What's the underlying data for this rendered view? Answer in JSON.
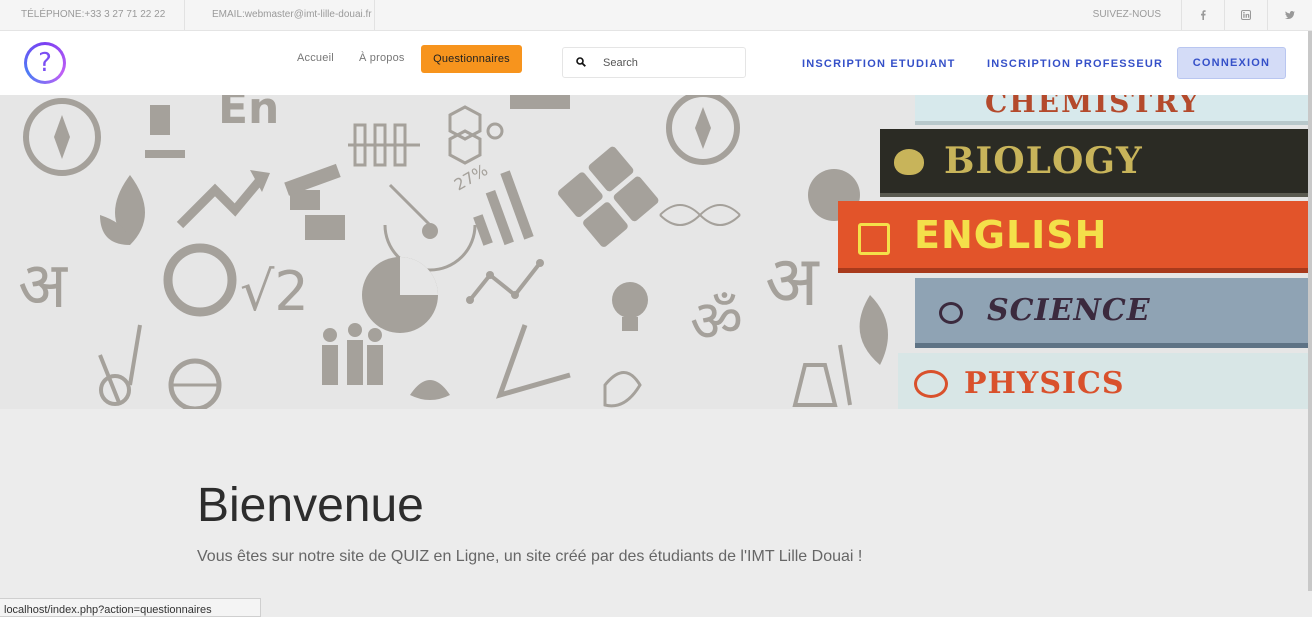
{
  "topbar": {
    "phone": "TÉLÉPHONE:+33 3 27 71 22 22",
    "email": "EMAIL:webmaster@imt-lille-douai.fr",
    "follow": "SUIVEZ-NOUS",
    "social_icons": [
      "facebook-icon",
      "linkedin-icon",
      "twitter-icon"
    ]
  },
  "nav": {
    "accueil": "Accueil",
    "apropos": "À propos",
    "questionnaires": "Questionnaires",
    "search_placeholder": "Search",
    "inscription_etudiant": "INSCRIPTION ETUDIANT",
    "inscription_professeur": "INSCRIPTION PROFESSEUR",
    "connexion": "CONNEXION"
  },
  "hero": {
    "books": [
      {
        "label": "CHEMISTRY",
        "bg": "#d7e9ec",
        "fg": "#b44a2c"
      },
      {
        "label": "BIOLOGY",
        "bg": "#2b2b24",
        "fg": "#c8b45a"
      },
      {
        "label": "ENGLISH",
        "bg": "#e2542a",
        "fg": "#f4e04a"
      },
      {
        "label": "SCIENCE",
        "bg": "#8fa3b4",
        "fg": "#3b2a3e"
      },
      {
        "label": "PHYSICS",
        "bg": "#d8e6e6",
        "fg": "#d9512c"
      }
    ]
  },
  "welcome": {
    "title": "Bienvenue",
    "subtitle": "Vous êtes sur notre site de QUIZ en Ligne, un site créé par des étudiants de l'IMT Lille Douai !"
  },
  "status_url": "localhost/index.php?action=questionnaires",
  "colors": {
    "accent": "#f7941d",
    "primary": "#3550c8"
  }
}
